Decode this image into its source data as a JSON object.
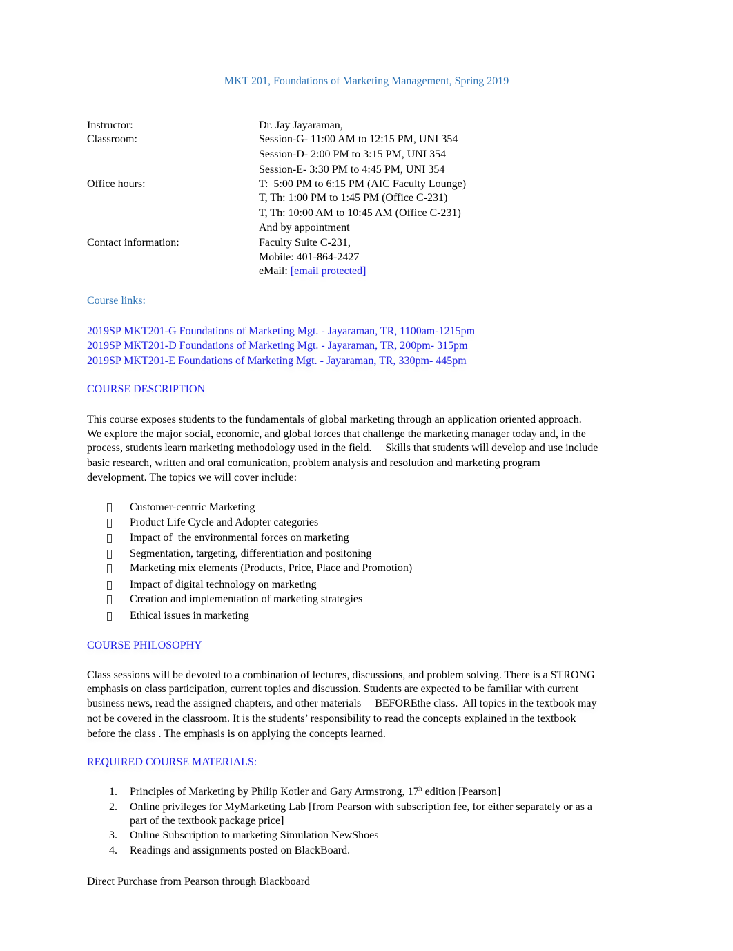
{
  "document": {
    "title": "MKT 201, Foundations of Marketing Management, Spring 2019",
    "info": {
      "instructor_label": "Instructor:",
      "instructor_value": "Dr. Jay Jayaraman,",
      "classroom_label": "Classroom:",
      "classroom_sessions": [
        "Session-G- 11:00 AM to 12:15 PM, UNI 354",
        "Session-D- 2:00 PM to 3:15 PM, UNI 354",
        "Session-E- 3:30 PM to 4:45 PM, UNI 354"
      ],
      "office_hours_label": "Office hours:",
      "office_hours": [
        "T:  5:00 PM to 6:15 PM (AIC Faculty Lounge)",
        "T, Th: 1:00 PM to 1:45 PM (Office C-231)",
        "T, Th: 10:00 AM to 10:45 AM (Office C-231)",
        "And by appointment"
      ],
      "contact_label": "Contact information:",
      "contact_lines": [
        "Faculty Suite C-231,",
        "Mobile: 401-864-2427"
      ],
      "email_prefix": "eMail: ",
      "email_link": "[email protected]"
    },
    "course_links_heading": "Course links:",
    "course_links": [
      "2019SP MKT201-G Foundations of Marketing Mgt. - Jayaraman, TR, 1100am-1215pm",
      "2019SP MKT201-D Foundations of Marketing Mgt. - Jayaraman, TR, 200pm- 315pm",
      "2019SP MKT201-E Foundations of Marketing Mgt. - Jayaraman, TR, 330pm- 445pm"
    ],
    "description_heading": "COURSE DESCRIPTION",
    "description_lines": [
      "This course exposes students to the fundamentals of global marketing through an application oriented approach.",
      "We explore the major social, economic, and global forces that challenge the marketing manager today and, in the",
      "process, students learn marketing methodology used in the field.     Skills that students will develop and use include",
      "basic research, written and oral comunication, problem analysis and resolution and marketing program",
      "development. The topics we will cover include:"
    ],
    "topics": [
      "Customer-centric Marketing",
      "Product Life Cycle and Adopter categories",
      "Impact of  the environmental forces on marketing",
      "Segmentation, targeting, differentiation and positoning",
      "Marketing mix elements (Products, Price, Place and Promotion)",
      "Impact of digital technology on marketing",
      "Creation and implementation of marketing strategies",
      "Ethical issues in marketing"
    ],
    "philosophy_heading": "COURSE PHILOSOPHY",
    "philosophy_lines": [
      "Class sessions will be devoted to a combination of lectures, discussions, and problem solving. There is a STRONG",
      "emphasis on class participation, current topics and discussion. Students are expected to be familiar with current",
      "business news, read the assigned chapters, and other materials     BEFOREthe class.  All topics in the textbook may",
      "not be covered in the classroom. It is the students’ responsibility to read the concepts explained in the textbook",
      "before the class . The emphasis is on applying the concepts learned."
    ],
    "materials_heading": "REQUIRED COURSE MATERIALS:",
    "materials": [
      {
        "num": "1.",
        "lines": [
          "Principles of Marketing by Philip Kotler and Gary Armstrong, 17"
        ],
        "sup": "th",
        "after_sup": " edition [Pearson]"
      },
      {
        "num": "2.",
        "lines": [
          "Online privileges for MyMarketing Lab [from Pearson with subscription fee, for either separately or as a",
          "part of the textbook package price]"
        ]
      },
      {
        "num": "3.",
        "lines": [
          "Online Subscription to marketing Simulation NewShoes"
        ]
      },
      {
        "num": "4.",
        "lines": [
          "Readings and assignments posted on BlackBoard."
        ]
      }
    ],
    "purchase_note": "Direct Purchase from Pearson through Blackboard"
  }
}
